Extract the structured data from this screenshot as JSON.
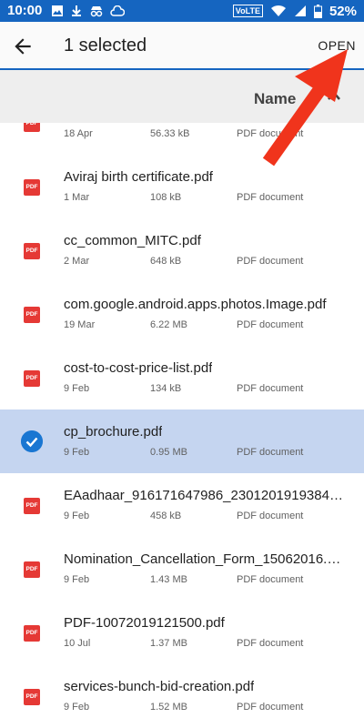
{
  "status": {
    "time": "10:00",
    "lte": "VoLTE",
    "battery": "52%"
  },
  "appbar": {
    "title": "1 selected",
    "open_label": "OPEN"
  },
  "sort": {
    "label": "Name"
  },
  "files": [
    {
      "name": "",
      "date": "18 Apr",
      "size": "56.33 kB",
      "type": "PDF document",
      "selected": false
    },
    {
      "name": "Aviraj birth certificate.pdf",
      "date": "1 Mar",
      "size": "108 kB",
      "type": "PDF document",
      "selected": false
    },
    {
      "name": "cc_common_MITC.pdf",
      "date": "2 Mar",
      "size": "648 kB",
      "type": "PDF document",
      "selected": false
    },
    {
      "name": "com.google.android.apps.photos.Image.pdf",
      "date": "19 Mar",
      "size": "6.22 MB",
      "type": "PDF document",
      "selected": false
    },
    {
      "name": "cost-to-cost-price-list.pdf",
      "date": "9 Feb",
      "size": "134 kB",
      "type": "PDF document",
      "selected": false
    },
    {
      "name": "cp_brochure.pdf",
      "date": "9 Feb",
      "size": "0.95 MB",
      "type": "PDF document",
      "selected": true
    },
    {
      "name": "EAadhaar_916171647986_2301201919384…",
      "date": "9 Feb",
      "size": "458 kB",
      "type": "PDF document",
      "selected": false
    },
    {
      "name": "Nomination_Cancellation_Form_15062016.…",
      "date": "9 Feb",
      "size": "1.43 MB",
      "type": "PDF document",
      "selected": false
    },
    {
      "name": "PDF-10072019121500.pdf",
      "date": "10 Jul",
      "size": "1.37 MB",
      "type": "PDF document",
      "selected": false
    },
    {
      "name": "services-bunch-bid-creation.pdf",
      "date": "9 Feb",
      "size": "1.52 MB",
      "type": "PDF document",
      "selected": false
    }
  ],
  "icons": {
    "pdf_badge": "PDF"
  },
  "colors": {
    "accent": "#1565c0",
    "selected_row": "#c5d5f0",
    "pdf_red": "#e53935",
    "annotation_arrow": "#f0341c"
  }
}
